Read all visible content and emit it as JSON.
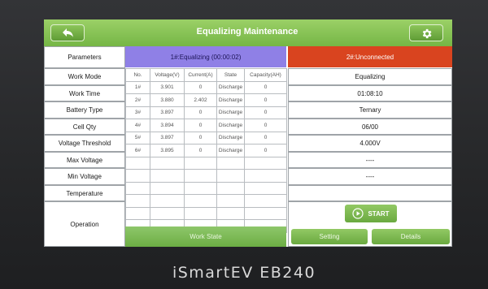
{
  "device": {
    "brand": "iSmartEV EB240"
  },
  "header": {
    "title": "Equalizing Maintenance",
    "back_icon": "back-arrow-icon",
    "settings_icon": "gear-icon"
  },
  "params": {
    "header": "Parameters",
    "items": [
      "Work Mode",
      "Work Time",
      "Battery Type",
      "Cell Qty",
      "Voltage Threshold",
      "Max Voltage",
      "Min Voltage",
      "Temperature",
      "Operation"
    ]
  },
  "channel1": {
    "title": "1#:Equalizing (00:00:02)",
    "columns": [
      "No.",
      "Voltage(V)",
      "Current(A)",
      "State",
      "Capacity(AH)"
    ],
    "rows": [
      [
        "1#",
        "3.901",
        "0",
        "Discharge",
        "0"
      ],
      [
        "2#",
        "3.880",
        "2.402",
        "Discharge",
        "0"
      ],
      [
        "3#",
        "3.897",
        "0",
        "Discharge",
        "0"
      ],
      [
        "4#",
        "3.894",
        "0",
        "Discharge",
        "0"
      ],
      [
        "5#",
        "3.897",
        "0",
        "Discharge",
        "0"
      ],
      [
        "6#",
        "3.895",
        "0",
        "Discharge",
        "0"
      ]
    ],
    "work_state_label": "Work State"
  },
  "channel2": {
    "title": "2#:Unconnected",
    "values": [
      "Equalizing",
      "01:08:10",
      "Ternary",
      "06/00",
      "4.000V",
      "----",
      "----",
      ""
    ]
  },
  "actions": {
    "start_label": "START",
    "setting_label": "Setting",
    "details_label": "Details"
  },
  "colors": {
    "header_green": "#75b645",
    "channel1_purple": "#8f80e6",
    "channel2_red": "#d9441f"
  }
}
